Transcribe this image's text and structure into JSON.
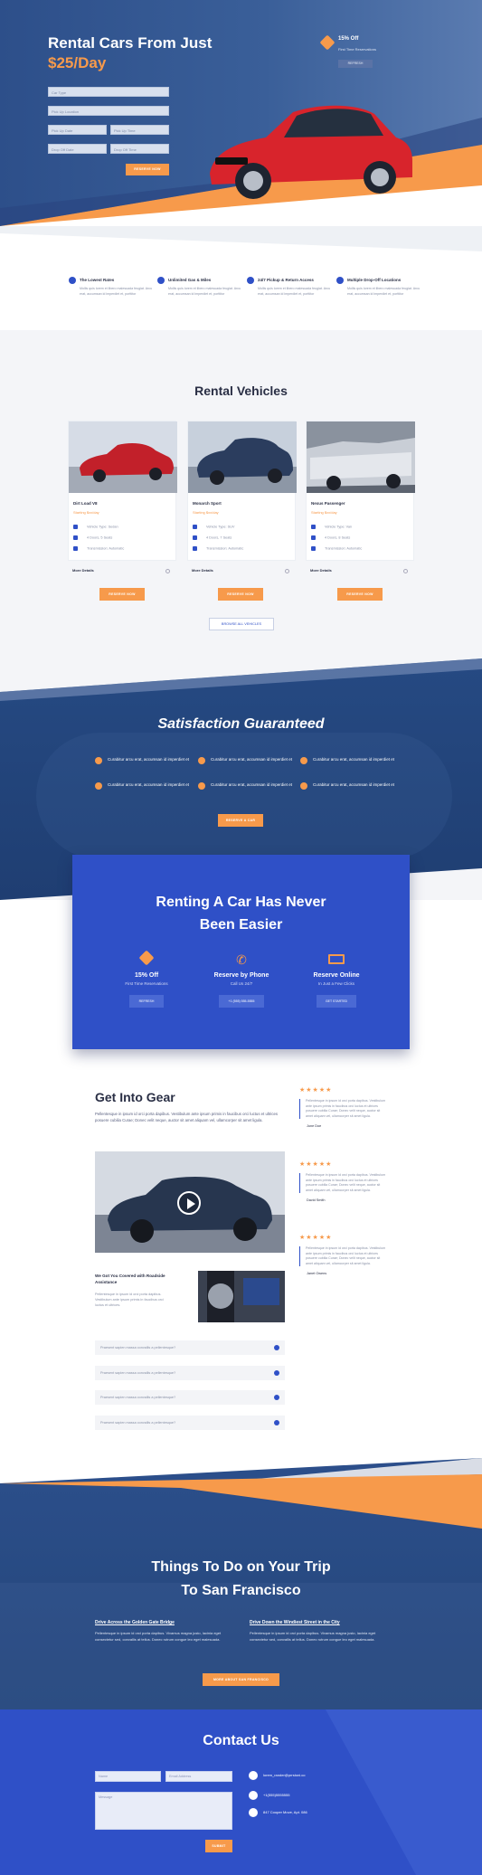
{
  "hero": {
    "title": "Rental Cars From Just",
    "price": "$25/Day",
    "car_type": "Car Type",
    "pickup_location": "Pick Up Location",
    "pickup_date": "Pick Up Date",
    "pickup_time": "Pick Up Time",
    "dropoff_date": "Drop Off Date",
    "dropoff_time": "Drop Off Time",
    "reserve": "RESERVE NOW",
    "promo_title": "15% Off",
    "promo_sub": "First Time Reservations",
    "promo_btn": "REFRESH"
  },
  "features": [
    {
      "title": "The Lowest Rates",
      "desc": "Mollis quis lorem et libero malesuada feugiat. Arcu erat, accumsan id imperdiet et, porttitor"
    },
    {
      "title": "Unlimited Gas & Miles",
      "desc": "Mollis quis lorem et libero malesuada feugiat. Arcu erat, accumsan id imperdiet et, porttitor"
    },
    {
      "title": "24/7 Pickup & Return Access",
      "desc": "Mollis quis lorem et libero malesuada feugiat. Arcu erat, accumsan id imperdiet et, porttitor"
    },
    {
      "title": "Multiple Drop-Off Locations",
      "desc": "Mollis quis lorem et libero malesuada feugiat. Arcu erat, accumsan id imperdiet et, porttitor"
    }
  ],
  "vehicles": {
    "title": "Rental Vehicles",
    "browse": "BROWSE ALL VEHICLES",
    "cards": [
      {
        "name": "Dirt Load V8",
        "price": "Starting $xx/day",
        "type": "Vehicle Type: Sedan",
        "doors": "4 Doors, 5 Seats",
        "trans": "Transmission: Automatic",
        "more": "More Details",
        "btn": "RESERVE NOW"
      },
      {
        "name": "Monarch Sport",
        "price": "Starting $xx/day",
        "type": "Vehicle Type: SUV",
        "doors": "4 Doors, 7 Seats",
        "trans": "Transmission: Automatic",
        "more": "More Details",
        "btn": "RESERVE NOW"
      },
      {
        "name": "Nexus Passenger",
        "price": "Starting $xx/day",
        "type": "Vehicle Type: Van",
        "doors": "4 Doors, 8 Seats",
        "trans": "Transmission: Automatic",
        "more": "More Details",
        "btn": "RESERVE NOW"
      }
    ]
  },
  "satisfaction": {
    "title": "Satisfaction Guaranteed",
    "item": "Curabitur arcu erat, accumsan id imperdiet et",
    "btn": "RESERVE A CAR"
  },
  "easier": {
    "title1": "Renting A Car Has Never",
    "title2": "Been Easier",
    "cols": [
      {
        "title": "15% Off",
        "sub": "First Time Reservations",
        "btn": "REFRESH"
      },
      {
        "title": "Reserve by Phone",
        "sub": "Call Us 24/7",
        "btn": "+1 (555) 555-5555"
      },
      {
        "title": "Reserve Online",
        "sub": "In Just a Few Clicks",
        "btn": "GET STARTED"
      }
    ]
  },
  "gear": {
    "title": "Get Into Gear",
    "text": "Pellentesque in ipsum id orci porta dapibus. Vestibulum ante ipsum primis in faucibus orci luctus et ultrices posuere cubilia Curae; Donec velit neque, auctor sit amet aliquam vel, ullamcorper sit amet ligula.",
    "covered_title": "We Got You Covered with Roadside Assistance",
    "covered_text": "Pellentesque in ipsum id orci porta dapibus. Vestibulum ante ipsum primis in faucibus orci luctus et ultrices.",
    "faq": "Praesent sapien massa convallis a pellentesque?"
  },
  "reviews": [
    {
      "stars": "★★★★★",
      "text": "Pellentesque in ipsum id orci porta dapibus. Vestibulum ante ipsum primis in faucibus orci luctus et ultrices posuere cubilia Curae; Donec velit neque, auctor sit amet aliquam vel, ullamcorper sit amet ligula.",
      "name": "June Doe"
    },
    {
      "stars": "★★★★★",
      "text": "Pellentesque in ipsum id orci porta dapibus. Vestibulum ante ipsum primis in faucibus orci luctus et ultrices posuere cubilia Curae; Donec velit neque, auctor sit amet aliquam vel, ullamcorper sit amet ligula.",
      "name": "David Smith"
    },
    {
      "stars": "★★★★★",
      "text": "Pellentesque in ipsum id orci porta dapibus. Vestibulum ante ipsum primis in faucibus orci luctus et ultrices posuere cubilia Curae; Donec velit neque, auctor sit amet aliquam vel, ullamcorper sit amet ligula.",
      "name": "Janet Owens"
    }
  ],
  "things": {
    "title1": "Things To Do on Your Trip",
    "title2": "To San Francisco",
    "a_title": "Drive Across the Golden Gate Bridge",
    "a_text": "Pellentesque in ipsum id orci porta dapibus. Vivamus magna justo, lacinia eget consectetur sed, convallis at tellus. Donec rutrum congue leo eget malesuada.",
    "b_title": "Drive Down the Windiest Street in the City",
    "b_text": "Pellentesque in ipsum id orci porta dapibus. Vivamus magna justo, lacinia eget consectetur sed, convallis at tellus. Donec rutrum congue leo eget malesuada.",
    "btn": "MORE ABOUT SAN FRANCISCO"
  },
  "contact": {
    "title": "Contact Us",
    "name": "Name",
    "email": "Email Address",
    "message": "Message",
    "submit": "SUBMIT",
    "email_val": "lorem_rander@prrstoni.co",
    "phone": "+1(555)5555555",
    "address": "847 Cooper Move, Apt. 086"
  },
  "colors": {
    "primary": "#2f50c7",
    "accent": "#f79a4b",
    "navy": "#2d4f8a"
  }
}
